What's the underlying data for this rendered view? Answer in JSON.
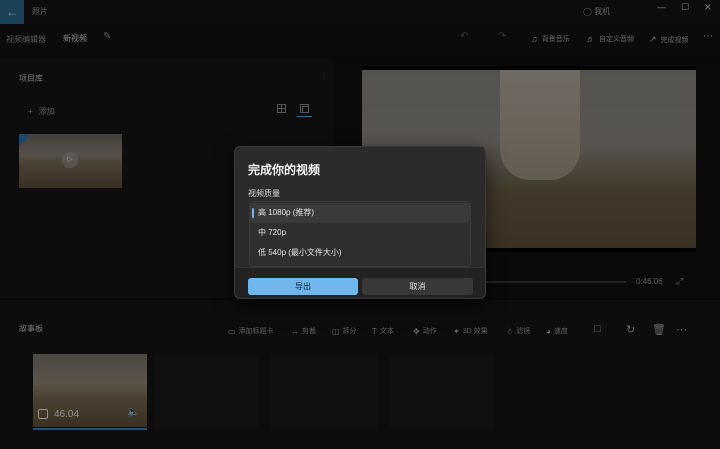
{
  "titlebar": {
    "back_icon": "back-arrow-icon",
    "app_title": "照片",
    "user_label": "我机",
    "controls": {
      "minimize": "—",
      "maximize": "☐",
      "close": "✕"
    }
  },
  "toolbar": {
    "breadcrumb_editor": "视频编辑器",
    "breadcrumb_current": "新视频",
    "buttons": {
      "music": "背景音乐",
      "custom_audio": "自定义音频",
      "finish": "完成视频"
    }
  },
  "library": {
    "title": "项目库",
    "add_label": "添加"
  },
  "preview": {
    "time": "0:46.06"
  },
  "storyboard": {
    "title": "故事板",
    "tools": {
      "title_card": "添加标题卡",
      "trim": "剪裁",
      "split": "拆分",
      "text": "文本",
      "motion": "动作",
      "effects_3d": "3D 效果",
      "filters": "滤镜",
      "speed": "速度"
    },
    "clip_duration": "46.04"
  },
  "dialog": {
    "title": "完成你的视频",
    "quality_label": "视频质量",
    "options": [
      {
        "label": "高 1080p (推荐)",
        "selected": true
      },
      {
        "label": "中 720p",
        "selected": false
      },
      {
        "label": "低 540p (最小文件大小)",
        "selected": false
      }
    ],
    "export_label": "导出",
    "cancel_label": "取消"
  },
  "colors": {
    "accent": "#6fb6ec",
    "back_button": "#2a6a8f",
    "clip_selection": "#2d86c9"
  }
}
